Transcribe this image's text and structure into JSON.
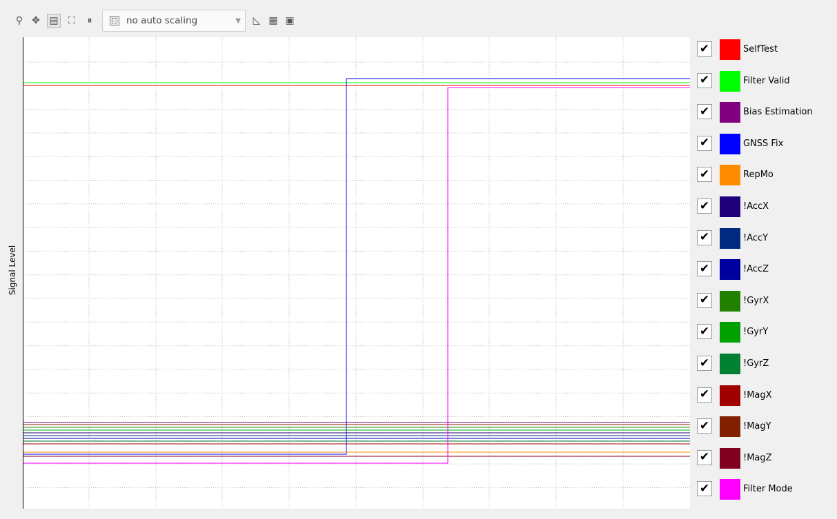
{
  "toolbar": {
    "buttons": [
      {
        "name": "zoom-icon",
        "glyph": "⚲"
      },
      {
        "name": "move-icon",
        "glyph": "✥"
      },
      {
        "name": "legend-toggle-icon",
        "glyph": "▤"
      },
      {
        "name": "fit-to-data-icon",
        "glyph": "⛶"
      },
      {
        "name": "pause-icon",
        "glyph": "⏸"
      }
    ],
    "scaling_select": {
      "value": "no auto scaling"
    },
    "right_buttons": [
      {
        "name": "ruler-icon",
        "glyph": "◺"
      },
      {
        "name": "table-icon",
        "glyph": "▦"
      },
      {
        "name": "export-icon",
        "glyph": "▣"
      }
    ]
  },
  "plot": {
    "ylabel": "Signal Level",
    "grid": true
  },
  "legend": {
    "items": [
      {
        "label": "SelfTest",
        "color": "#ff0000",
        "checked": true
      },
      {
        "label": "Filter Valid",
        "color": "#00ff00",
        "checked": true
      },
      {
        "label": "Bias Estimation",
        "color": "#800080",
        "checked": true
      },
      {
        "label": "GNSS Fix",
        "color": "#0000ff",
        "checked": true
      },
      {
        "label": "RepMo",
        "color": "#ff8c00",
        "checked": true
      },
      {
        "label": "!AccX",
        "color": "#1f007a",
        "checked": true
      },
      {
        "label": "!AccY",
        "color": "#002a7f",
        "checked": true
      },
      {
        "label": "!AccZ",
        "color": "#00009e",
        "checked": true
      },
      {
        "label": "!GyrX",
        "color": "#228000",
        "checked": true
      },
      {
        "label": "!GyrY",
        "color": "#00a000",
        "checked": true
      },
      {
        "label": "!GyrZ",
        "color": "#008030",
        "checked": true
      },
      {
        "label": "!MagX",
        "color": "#a00000",
        "checked": true
      },
      {
        "label": "!MagY",
        "color": "#802000",
        "checked": true
      },
      {
        "label": "!MagZ",
        "color": "#800020",
        "checked": true
      },
      {
        "label": "Filter Mode",
        "color": "#ff00ff",
        "checked": true
      }
    ]
  },
  "check_glyph": "✔"
}
